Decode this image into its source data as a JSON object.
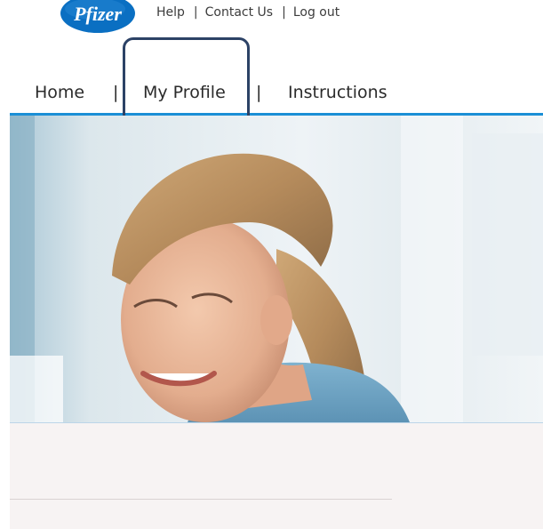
{
  "brand": {
    "logo_text": "Pfizer",
    "logo_color": "#0a6fc2"
  },
  "utility_nav": {
    "help": "Help",
    "contact": "Contact Us",
    "logout": "Log out",
    "separator": "|"
  },
  "main_nav": {
    "items": [
      {
        "label": "Home"
      },
      {
        "label": "My Profile"
      },
      {
        "label": "Instructions"
      }
    ],
    "separator": "|",
    "highlighted": "My Profile",
    "accent_color": "#1b8fd6",
    "highlight_color": "#2c4266"
  },
  "hero": {
    "image": "hero-photo-smiling-woman"
  }
}
